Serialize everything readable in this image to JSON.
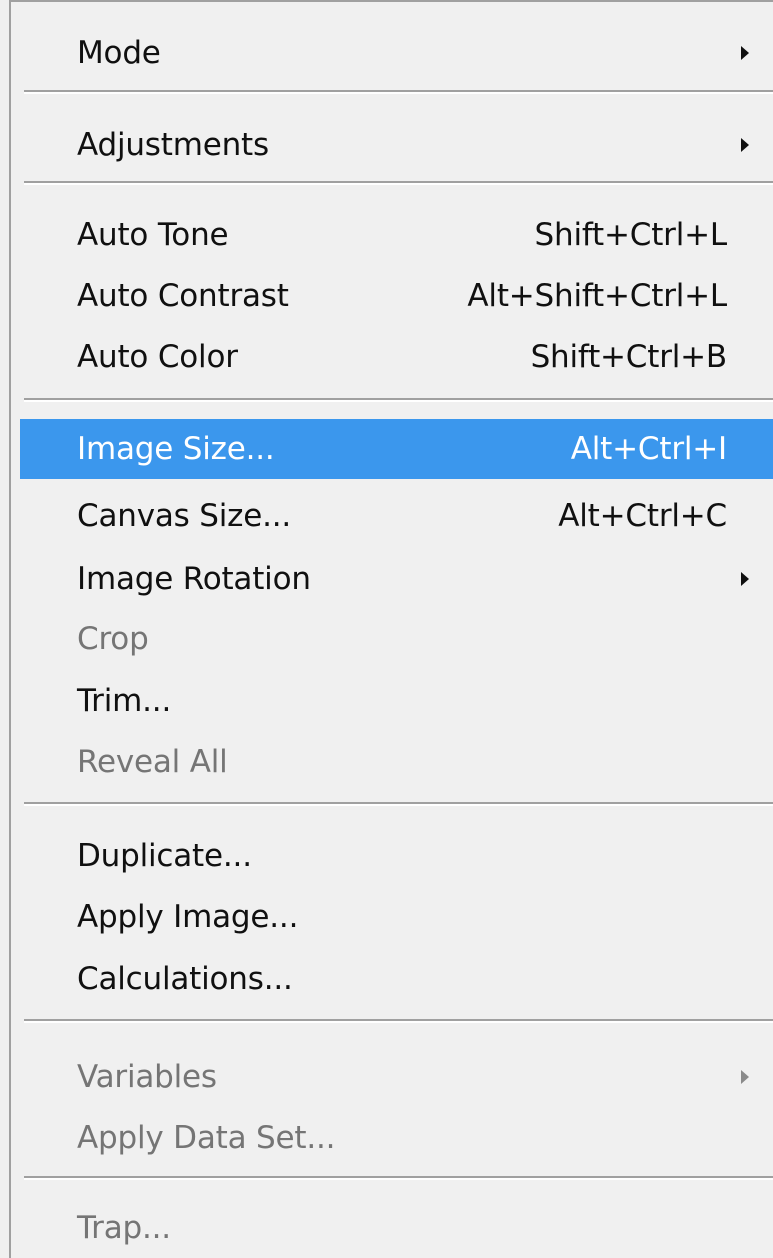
{
  "menu": {
    "items": {
      "mode": {
        "label": "Mode"
      },
      "adjustments": {
        "label": "Adjustments"
      },
      "auto_tone": {
        "label": "Auto Tone",
        "shortcut": "Shift+Ctrl+L"
      },
      "auto_contrast": {
        "label": "Auto Contrast",
        "shortcut": "Alt+Shift+Ctrl+L"
      },
      "auto_color": {
        "label": "Auto Color",
        "shortcut": "Shift+Ctrl+B"
      },
      "image_size": {
        "label": "Image Size...",
        "shortcut": "Alt+Ctrl+I"
      },
      "canvas_size": {
        "label": "Canvas Size...",
        "shortcut": "Alt+Ctrl+C"
      },
      "image_rotation": {
        "label": "Image Rotation"
      },
      "crop": {
        "label": "Crop"
      },
      "trim": {
        "label": "Trim..."
      },
      "reveal_all": {
        "label": "Reveal All"
      },
      "duplicate": {
        "label": "Duplicate..."
      },
      "apply_image": {
        "label": "Apply Image..."
      },
      "calculations": {
        "label": "Calculations..."
      },
      "variables": {
        "label": "Variables"
      },
      "apply_data_set": {
        "label": "Apply Data Set..."
      },
      "trap": {
        "label": "Trap..."
      }
    },
    "highlighted_item": "Image Size...",
    "disabled_items": [
      "Crop",
      "Reveal All",
      "Variables",
      "Apply Data Set...",
      "Trap..."
    ],
    "submenu_items": [
      "Mode",
      "Adjustments",
      "Image Rotation",
      "Variables"
    ],
    "colors": {
      "menu_background": "#f0f0f0",
      "highlight": "#3b97ed",
      "text": "#101010",
      "disabled_text": "#757575",
      "separator": "#a0a0a0"
    },
    "icons": {
      "submenu_arrow": "submenu-arrow-icon"
    }
  }
}
